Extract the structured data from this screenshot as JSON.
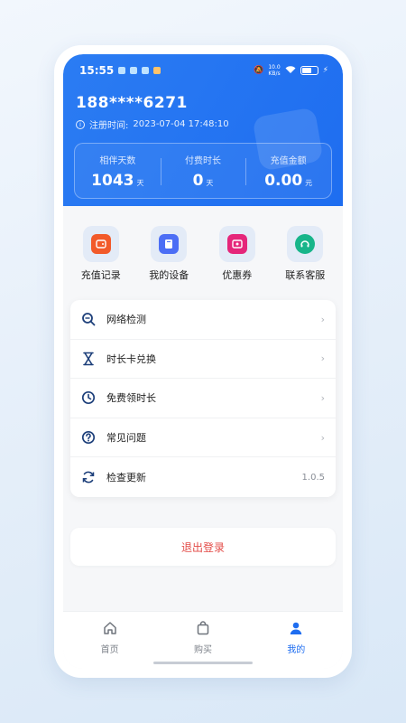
{
  "status_bar": {
    "time": "15:55",
    "net_speed_value": "10.0",
    "net_speed_unit": "KB/s",
    "battery_glyph": "⚡"
  },
  "account": {
    "phone": "188****6271",
    "register_label": "注册时间:",
    "register_time": "2023-07-04 17:48:10"
  },
  "stats": [
    {
      "label": "相伴天数",
      "value": "1043",
      "unit": "天"
    },
    {
      "label": "付费时长",
      "value": "0",
      "unit": "天"
    },
    {
      "label": "充值金额",
      "value": "0.00",
      "unit": "元"
    }
  ],
  "quick_actions": [
    {
      "label": "充值记录",
      "icon": "wallet-icon",
      "color": "#f25a2a"
    },
    {
      "label": "我的设备",
      "icon": "device-icon",
      "color": "#4c6ef5"
    },
    {
      "label": "优惠券",
      "icon": "coupon-icon",
      "color": "#e5267a"
    },
    {
      "label": "联系客服",
      "icon": "support-icon",
      "color": "#17b58a"
    }
  ],
  "menu": [
    {
      "label": "网络检测",
      "icon": "network-check-icon",
      "trail": "›"
    },
    {
      "label": "时长卡兑换",
      "icon": "hourglass-icon",
      "trail": "›"
    },
    {
      "label": "免费领时长",
      "icon": "clock-icon",
      "trail": "›"
    },
    {
      "label": "常见问题",
      "icon": "question-icon",
      "trail": "›"
    },
    {
      "label": "检查更新",
      "icon": "refresh-icon",
      "trail": "1.0.5"
    }
  ],
  "logout_label": "退出登录",
  "tabs": [
    {
      "label": "首页",
      "icon": "home-icon"
    },
    {
      "label": "购买",
      "icon": "shopping-bag-icon"
    },
    {
      "label": "我的",
      "icon": "user-icon"
    }
  ],
  "colors": {
    "brand_blue": "#1e6df0",
    "logout_red": "#e34b47",
    "icon_navy": "#1d3f7a"
  }
}
